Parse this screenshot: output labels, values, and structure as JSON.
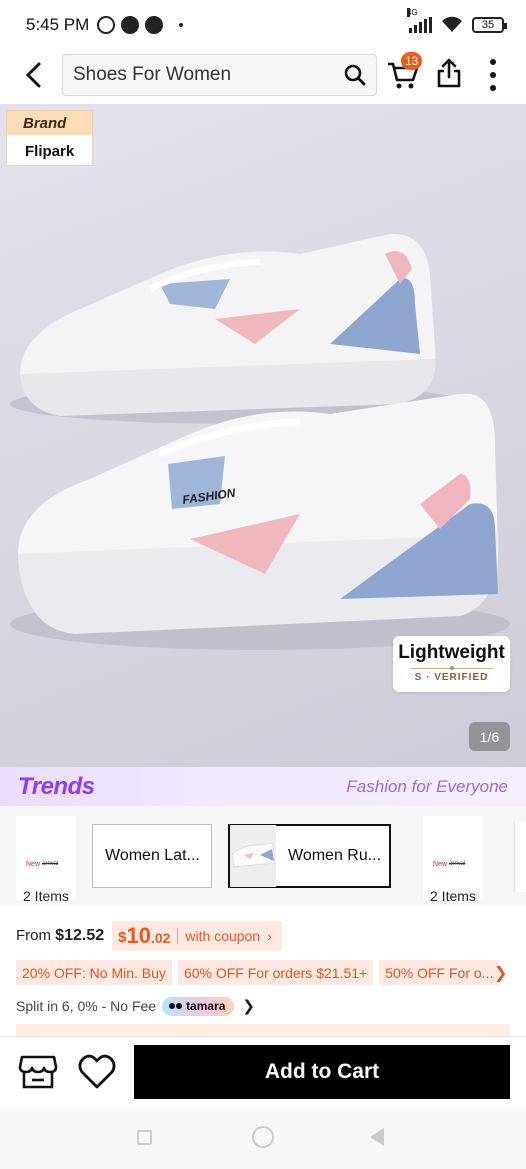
{
  "status_bar": {
    "time": "5:45 PM",
    "network": "4G",
    "battery": "35",
    "icons": [
      "whatsapp-icon",
      "messenger-icon",
      "messenger-icon",
      "dot-icon",
      "signal-icon",
      "wifi-icon",
      "battery-icon"
    ]
  },
  "header": {
    "search_value": "Shoes For Women",
    "cart_badge": "13",
    "icons": [
      "back-arrow-icon",
      "search-icon",
      "cart-icon",
      "share-icon",
      "more-vert-icon"
    ]
  },
  "product_image": {
    "brand_label": "Brand",
    "brand_name": "Flipark",
    "shoe_text": "FASHION",
    "badge_title": "Lightweight",
    "badge_sub": "S · VERIFIED",
    "counter": "1/6"
  },
  "trends": {
    "logo": "Trends",
    "tagline": "Fashion for Everyone",
    "accent": "#8b3df7"
  },
  "thumbnails": [
    {
      "type": "small",
      "count": "2 Items",
      "mini_a": "New",
      "mini_b": "arrival"
    },
    {
      "type": "wide",
      "label": "Women Lat...",
      "selected": false
    },
    {
      "type": "wide",
      "label": "Women Ru...",
      "selected": true
    },
    {
      "type": "small",
      "count": "2 Items",
      "mini_a": "New",
      "mini_b": "arrival"
    }
  ],
  "price": {
    "from_label": "From",
    "from_price": "$12.52",
    "coupon_currency": "$",
    "coupon_whole": "10",
    "coupon_decimal": ".02",
    "coupon_label": "with coupon",
    "accent": "#e85a1f"
  },
  "offers": [
    "20% OFF: No Min. Buy",
    "60% OFF For orders $21.51+",
    "50% OFF For o..."
  ],
  "split": {
    "text": "Split in 6, 0% - No Fee",
    "provider": "tamara"
  },
  "action_bar": {
    "add_to_cart": "Add to Cart",
    "icons": [
      "store-icon",
      "heart-icon"
    ]
  }
}
